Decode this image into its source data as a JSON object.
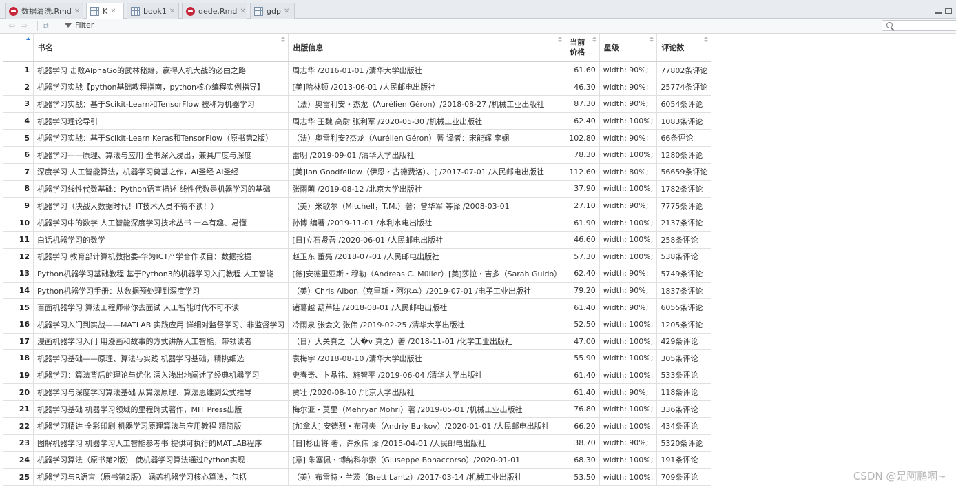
{
  "tabs": [
    {
      "label": "数据清洗.Rmd",
      "icon": "rmd-file-icon",
      "active": false
    },
    {
      "label": "K",
      "icon": "data-grid-icon",
      "active": true
    },
    {
      "label": "book1",
      "icon": "data-grid-icon",
      "active": false
    },
    {
      "label": "dede.Rmd",
      "icon": "rmd-file-icon",
      "active": false
    },
    {
      "label": "gdp",
      "icon": "data-grid-icon",
      "active": false
    }
  ],
  "toolbar": {
    "filter_label": "Filter",
    "search_placeholder": ""
  },
  "table": {
    "headers": [
      "书名",
      "出版信息",
      "当前价格",
      "星级",
      "评论数"
    ],
    "rows": [
      [
        "1",
        "机器学习 击败AlphaGo的武林秘籍，赢得人机大战的必由之路",
        "周志华 /2016-01-01 /清华大学出版社",
        "61.60",
        "width: 90%;",
        "77802条评论"
      ],
      [
        "2",
        "机器学习实战【python基础教程指南，python核心编程实例指导】",
        "[美]哈林顿 /2013-06-01 /人民邮电出版社",
        "46.30",
        "width: 90%;",
        "25774条评论"
      ],
      [
        "3",
        "机器学习实战：基于Scikit-Learn和TensorFlow 被称为机器学习",
        "（法）奥雷利安・杰龙（Aurélien Géron）/2018-08-27 /机械工业出版社",
        "87.30",
        "width: 90%;",
        "6054条评论"
      ],
      [
        "4",
        "机器学习理论导引",
        "周志华 王魏 高尉 张利军 /2020-05-30 /机械工业出版社",
        "62.40",
        "width: 100%;",
        "1083条评论"
      ],
      [
        "5",
        "机器学习实战：基于Scikit-Learn Keras和TensorFlow（原书第2版）",
        "（法）奥雷利安?杰龙（Aurélien Géron）著 译者：宋能辉 李娴",
        "102.80",
        "width: 90%;",
        "66条评论"
      ],
      [
        "6",
        "机器学习——原理、算法与应用 全书深入浅出，兼具广度与深度",
        "雷明 /2019-09-01 /清华大学出版社",
        "78.30",
        "width: 100%;",
        "1280条评论"
      ],
      [
        "7",
        "深度学习 人工智能算法，机器学习奠基之作，AI圣经 AI圣经",
        "[美]Ian Goodfellow（伊恩・古德费洛）、[ /2017-07-01 /人民邮电出版社",
        "112.60",
        "width: 80%;",
        "56659条评论"
      ],
      [
        "8",
        "机器学习线性代数基础：Python语言描述 线性代数是机器学习的基础",
        "张雨萌 /2019-08-12 /北京大学出版社",
        "37.90",
        "width: 100%;",
        "1782条评论"
      ],
      [
        "9",
        "机器学习（决战大数据时代！IT技术人员不得不读！）",
        "（美）米歇尔（Mitchell，T.M.）著；曾华军 等译 /2008-03-01",
        "27.10",
        "width: 90%;",
        "7775条评论"
      ],
      [
        "10",
        "机器学习中的数学 人工智能深度学习技术丛书 一本有趣、易懂",
        "孙博 编著 /2019-11-01 /水利水电出版社",
        "61.90",
        "width: 100%;",
        "2137条评论"
      ],
      [
        "11",
        "白话机器学习的数学",
        "[日]立石贤吾 /2020-06-01 /人民邮电出版社",
        "46.60",
        "width: 100%;",
        "258条评论"
      ],
      [
        "12",
        "机器学习 教育部计算机教指委-华为ICT产学合作项目：数据挖掘",
        "赵卫东 董亮 /2018-07-01 /人民邮电出版社",
        "57.30",
        "width: 100%;",
        "538条评论"
      ],
      [
        "13",
        "Python机器学习基础教程 基于Python3的机器学习入门教程 人工智能",
        "[德]安德里亚斯・穆勒（Andreas C. Müller）[美]莎拉・吉多（Sarah Guido）",
        "62.40",
        "width: 90%;",
        "5749条评论"
      ],
      [
        "14",
        "Python机器学习手册：从数据预处理到深度学习",
        "（美）Chris Albon（克里斯・阿尔本）/2019-07-01 /电子工业出版社",
        "79.20",
        "width: 90%;",
        "1837条评论"
      ],
      [
        "15",
        "百面机器学习 算法工程师带你去面试 人工智能时代不可不读",
        "诸葛越 葫芦娃 /2018-08-01 /人民邮电出版社",
        "61.40",
        "width: 90%;",
        "6055条评论"
      ],
      [
        "16",
        "机器学习入门到实战——MATLAB 实践应用 详细对监督学习、非监督学习",
        "冷雨泉 张会文 张伟 /2019-02-25 /清华大学出版社",
        "52.50",
        "width: 100%;",
        "1205条评论"
      ],
      [
        "17",
        "漫画机器学习入门 用漫画和故事的方式讲解人工智能，带领读者",
        "（日）大关真之（大�v 真之）著 /2018-11-01 /化学工业出版社",
        "47.00",
        "width: 100%;",
        "429条评论"
      ],
      [
        "18",
        "机器学习基础——原理、算法与实践 机器学习基础，精挑细选",
        "袁梅宇 /2018-08-10 /清华大学出版社",
        "55.90",
        "width: 100%;",
        "305条评论"
      ],
      [
        "19",
        "机器学习：算法背后的理论与优化 深入浅出地阐述了经典机器学习",
        "史春奇、卜晶祎、施智平 /2019-06-04 /清华大学出版社",
        "61.40",
        "width: 100%;",
        "533条评论"
      ],
      [
        "20",
        "机器学习与深度学习算法基础 从算法原理、算法思维到公式推导",
        "贾壮 /2020-08-10 /北京大学出版社",
        "61.40",
        "width: 90%;",
        "118条评论"
      ],
      [
        "21",
        "机器学习基础 机器学习领域的里程碑式著作，MIT Press出版",
        "梅尔亚・莫里（Mehryar Mohri）著 /2019-05-01 /机械工业出版社",
        "76.80",
        "width: 100%;",
        "336条评论"
      ],
      [
        "22",
        "机器学习精讲 全彩印刷 机器学习原理算法与应用教程 精简版",
        "[加拿大] 安德烈・布可夫（Andriy Burkov）/2020-01-01 /人民邮电出版社",
        "66.20",
        "width: 100%;",
        "434条评论"
      ],
      [
        "23",
        "图解机器学习 机器学习人工智能参考书 提供可执行的MATLAB程序",
        "[日]杉山将 著，许永伟 译 /2015-04-01 /人民邮电出版社",
        "38.70",
        "width: 90%;",
        "5320条评论"
      ],
      [
        "24",
        "机器学习算法（原书第2版） 使机器学习算法通过Python实现",
        "[意] 朱塞佩・博纳科尔索（Giuseppe Bonaccorso）/2020-01-01",
        "68.30",
        "width: 100%;",
        "191条评论"
      ],
      [
        "25",
        "机器学习与R语言（原书第2版） 涵盖机器学习核心算法，包括",
        "（美）布雷特・兰茨（Brett Lantz）/2017-03-14 /机械工业出版社",
        "53.50",
        "width: 100%;",
        "709条评论"
      ]
    ]
  },
  "watermark": "CSDN @是阿鹏啊~"
}
